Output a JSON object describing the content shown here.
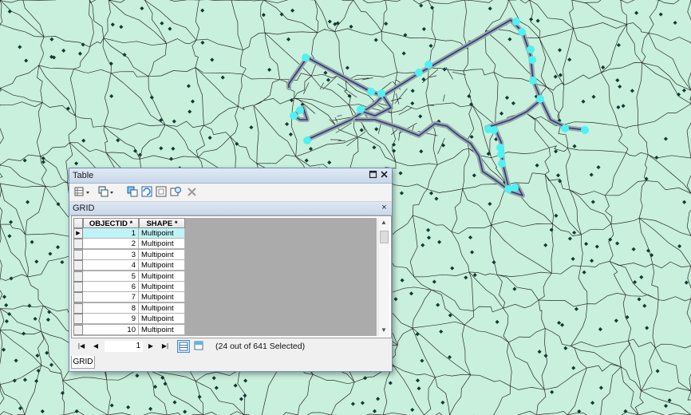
{
  "table_window": {
    "title": "Table",
    "pin_icon": "restore-square",
    "close_icon": "close-x",
    "tab_label": "GRID",
    "tab_close": "×",
    "bottom_tab": "GRID",
    "toolbar_icons": [
      "table-options",
      "related-tables",
      "select-by-attributes",
      "switch-selection",
      "clear-selection",
      "zoom-to-selected",
      "delete-selected"
    ],
    "columns": [
      "OBJECTID *",
      "SHAPE *"
    ],
    "rows": [
      {
        "id": "1",
        "shape": "Multipoint"
      },
      {
        "id": "2",
        "shape": "Multipoint"
      },
      {
        "id": "3",
        "shape": "Multipoint"
      },
      {
        "id": "4",
        "shape": "Multipoint"
      },
      {
        "id": "5",
        "shape": "Multipoint"
      },
      {
        "id": "6",
        "shape": "Multipoint"
      },
      {
        "id": "7",
        "shape": "Multipoint"
      },
      {
        "id": "8",
        "shape": "Multipoint"
      },
      {
        "id": "9",
        "shape": "Multipoint"
      },
      {
        "id": "10",
        "shape": "Multipoint"
      }
    ],
    "nav": {
      "first": "|◀",
      "prev": "◀",
      "record": "1",
      "next": "▶",
      "last": "▶|"
    },
    "selection_status": "(24 out of 641 Selected)"
  },
  "map": {
    "background_color": "#c8f0dc",
    "boundary_color": "#2b2b2b",
    "point_color": "#123a34",
    "selected_color": "#4ff2f2",
    "route_color": "#2a3a8c"
  }
}
